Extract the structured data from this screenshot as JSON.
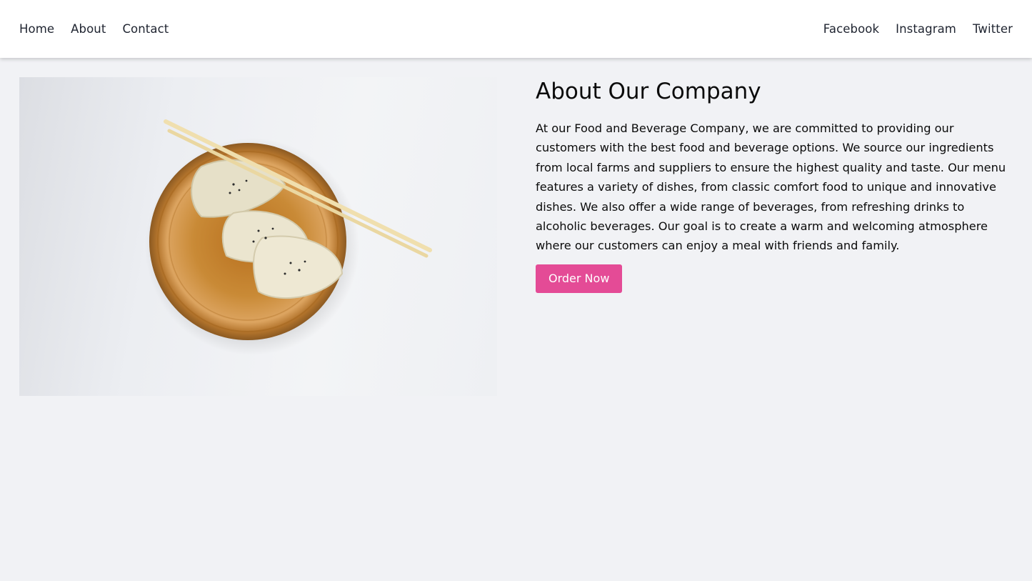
{
  "nav": {
    "left": [
      {
        "label": "Home"
      },
      {
        "label": "About"
      },
      {
        "label": "Contact"
      }
    ],
    "right": [
      {
        "label": "Facebook"
      },
      {
        "label": "Instagram"
      },
      {
        "label": "Twitter"
      }
    ]
  },
  "hero": {
    "image_alt": "Dumplings in a wooden bowl with chopsticks",
    "title": "About Our Company",
    "body": "At our Food and Beverage Company, we are committed to providing our customers with the best food and beverage options. We source our ingredients from local farms and suppliers to ensure the highest quality and taste. Our menu features a variety of dishes, from classic comfort food to unique and innovative dishes. We also offer a wide range of beverages, from refreshing drinks to alcoholic beverages. Our goal is to create a warm and welcoming atmosphere where our customers can enjoy a meal with friends and family.",
    "cta_label": "Order Now"
  },
  "colors": {
    "page_bg": "#f1f2f5",
    "nav_bg": "#ffffff",
    "accent": "#e44b96",
    "text": "#1f2430"
  }
}
